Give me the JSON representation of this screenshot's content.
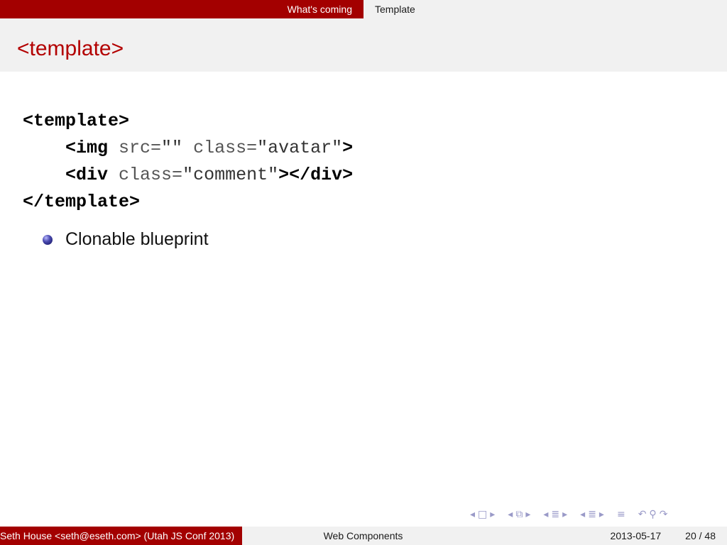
{
  "nav": {
    "sections": [
      "What's coming",
      "Template"
    ]
  },
  "slide": {
    "title": "<template>",
    "code": {
      "line1": "<template>",
      "line2_tag": "<img",
      "line2_attr1": " src=",
      "line2_val1": "\"\"",
      "line2_attr2": " class=",
      "line2_val2": "\"avatar\"",
      "line2_close": ">",
      "line3_tag": "<div",
      "line3_attr": " class=",
      "line3_val": "\"comment\"",
      "line3_close": "></div>",
      "line4": "</template>"
    },
    "bullets": [
      "Clonable blueprint"
    ]
  },
  "footer": {
    "author": "Seth House <seth@eseth.com>  (Utah JS Conf 2013)",
    "talk": "Web Components",
    "date": "2013-05-17",
    "page": "20 / 48"
  },
  "icons": {
    "nav_symbols": [
      "arrow-left-icon",
      "frame-icon",
      "arrow-right-icon",
      "subsection-icon",
      "section-icon",
      "outline-icon",
      "undo-icon",
      "search-icon"
    ]
  }
}
